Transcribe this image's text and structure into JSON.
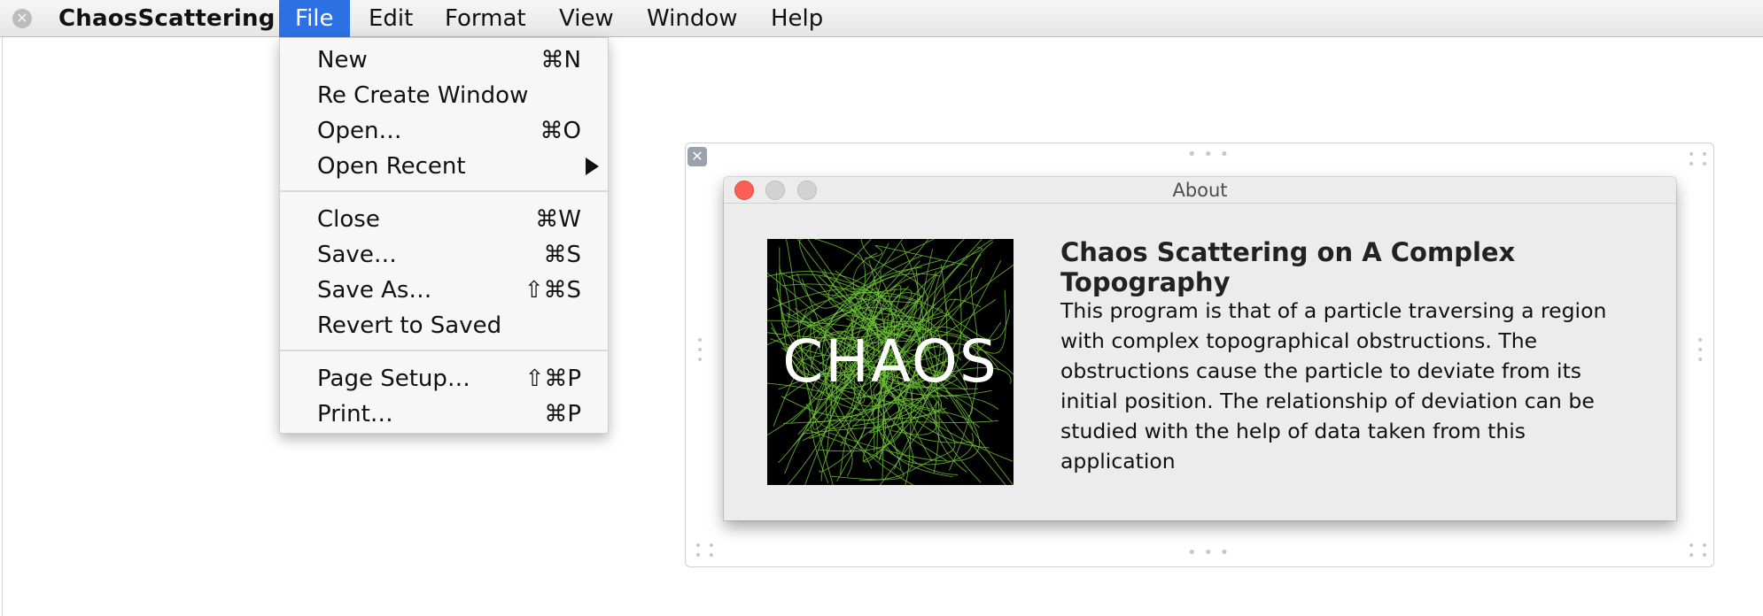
{
  "menubar": {
    "app_name": "ChaosScattering",
    "menus": [
      "File",
      "Edit",
      "Format",
      "View",
      "Window",
      "Help"
    ],
    "active_menu": "File"
  },
  "file_menu": {
    "items": [
      {
        "label": "New",
        "shortcut": "⌘N"
      },
      {
        "label": "Re Create Window",
        "shortcut": ""
      },
      {
        "label": "Open…",
        "shortcut": "⌘O"
      },
      {
        "label": "Open Recent",
        "shortcut": "",
        "submenu": true
      },
      {
        "label": "Close",
        "shortcut": "⌘W"
      },
      {
        "label": "Save…",
        "shortcut": "⌘S"
      },
      {
        "label": "Save As…",
        "shortcut": "⇧⌘S"
      },
      {
        "label": "Revert to Saved",
        "shortcut": ""
      },
      {
        "label": "Page Setup…",
        "shortcut": "⇧⌘P"
      },
      {
        "label": "Print…",
        "shortcut": "⌘P"
      }
    ]
  },
  "about_window": {
    "title": "About",
    "logo_text": "CHAOS",
    "heading": "Chaos Scattering on A Complex Topography",
    "body": "This program is that of a particle traversing a region with complex topographical obstructions. The obstructions cause the particle to deviate from its initial position. The relationship of deviation can be studied with the help of data taken from this application"
  },
  "colors": {
    "menu_highlight": "#2c71e3",
    "logo_lines": "#6fc23a",
    "close_red": "#fc5f57"
  },
  "icons": {
    "menubar_close": "close-circle-icon",
    "frame_close": "close-box-icon",
    "submenu": "triangle-right-icon"
  }
}
